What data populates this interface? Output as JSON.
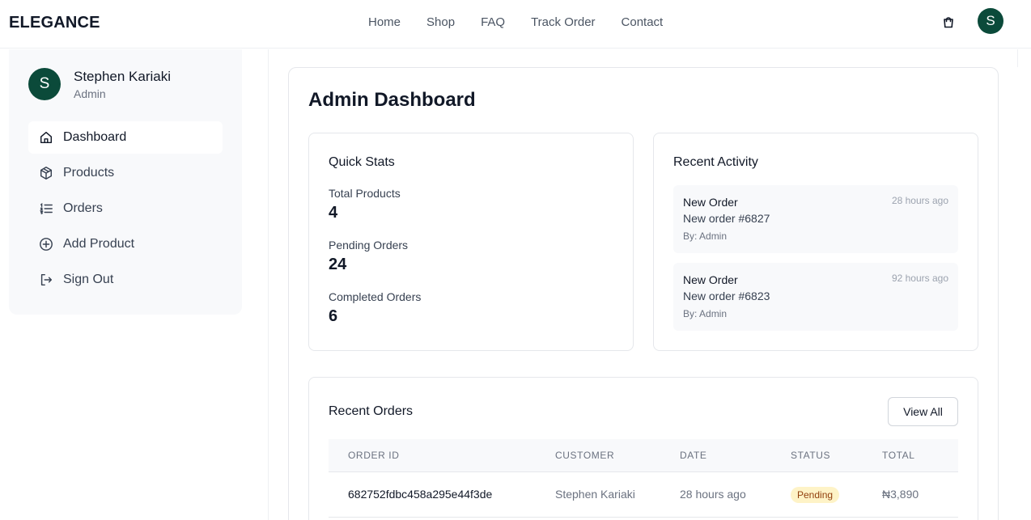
{
  "header": {
    "brand": "ELEGANCE",
    "nav": [
      "Home",
      "Shop",
      "FAQ",
      "Track Order",
      "Contact"
    ],
    "cart_icon": "shopping-bag-icon",
    "avatar_initial": "S"
  },
  "sidebar": {
    "avatar_initial": "S",
    "user_name": "Stephen Kariaki",
    "user_role": "Admin",
    "items": [
      {
        "label": "Dashboard",
        "icon": "home-icon",
        "active": true
      },
      {
        "label": "Products",
        "icon": "package-icon",
        "active": false
      },
      {
        "label": "Orders",
        "icon": "list-icon",
        "active": false
      },
      {
        "label": "Add Product",
        "icon": "plus-circle-icon",
        "active": false
      },
      {
        "label": "Sign Out",
        "icon": "sign-out-icon",
        "active": false
      }
    ]
  },
  "main": {
    "title": "Admin Dashboard",
    "quick_stats": {
      "title": "Quick Stats",
      "stats": [
        {
          "label": "Total Products",
          "value": "4"
        },
        {
          "label": "Pending Orders",
          "value": "24"
        },
        {
          "label": "Completed Orders",
          "value": "6"
        }
      ]
    },
    "recent_activity": {
      "title": "Recent Activity",
      "items": [
        {
          "title": "New Order",
          "desc": "New order #6827",
          "by": "By: Admin",
          "time": "28 hours ago"
        },
        {
          "title": "New Order",
          "desc": "New order #6823",
          "by": "By: Admin",
          "time": "92 hours ago"
        }
      ]
    },
    "recent_orders": {
      "title": "Recent Orders",
      "view_all": "View All",
      "columns": [
        "ORDER ID",
        "CUSTOMER",
        "DATE",
        "STATUS",
        "TOTAL"
      ],
      "rows": [
        {
          "id": "682752fdbc458a295e44f3de",
          "customer": "Stephen Kariaki",
          "date": "28 hours ago",
          "status": "Pending",
          "total": "₦3,890"
        }
      ]
    }
  },
  "colors": {
    "brand_green": "#0b4a3a",
    "pending_bg": "#fef3c7",
    "pending_text": "#92400e"
  }
}
